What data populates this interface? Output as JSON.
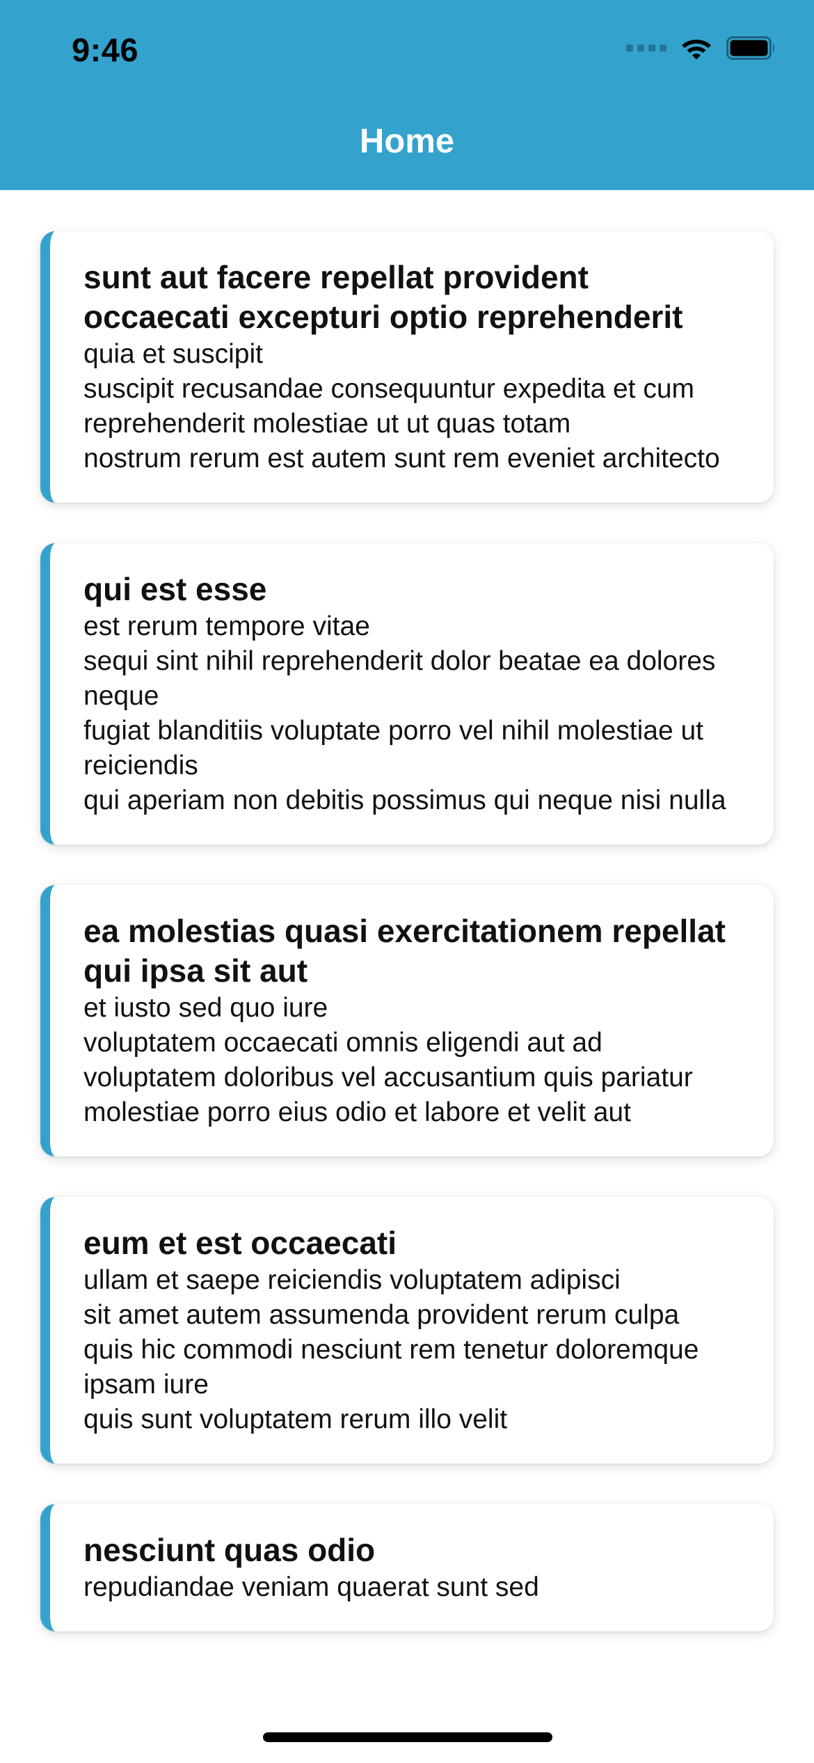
{
  "status_bar": {
    "time": "9:46"
  },
  "header": {
    "title": "Home"
  },
  "colors": {
    "accent": "#33a3cd",
    "card_background": "#ffffff",
    "text": "#111111"
  },
  "posts": [
    {
      "title": "sunt aut facere repellat provident occaecati excepturi optio reprehenderit",
      "body": "quia et suscipit\nsuscipit recusandae consequuntur expedita et cum\nreprehenderit molestiae ut ut quas totam\nnostrum rerum est autem sunt rem eveniet architecto"
    },
    {
      "title": "qui est esse",
      "body": "est rerum tempore vitae\nsequi sint nihil reprehenderit dolor beatae ea dolores neque\nfugiat blanditiis voluptate porro vel nihil molestiae ut reiciendis\nqui aperiam non debitis possimus qui neque nisi nulla"
    },
    {
      "title": "ea molestias quasi exercitationem repellat qui ipsa sit aut",
      "body": "et iusto sed quo iure\nvoluptatem occaecati omnis eligendi aut ad\nvoluptatem doloribus vel accusantium quis pariatur\nmolestiae porro eius odio et labore et velit aut"
    },
    {
      "title": "eum et est occaecati",
      "body": "ullam et saepe reiciendis voluptatem adipisci\nsit amet autem assumenda provident rerum culpa\nquis hic commodi nesciunt rem tenetur doloremque ipsam iure\nquis sunt voluptatem rerum illo velit"
    },
    {
      "title": "nesciunt quas odio",
      "body": "repudiandae veniam quaerat sunt sed"
    }
  ]
}
